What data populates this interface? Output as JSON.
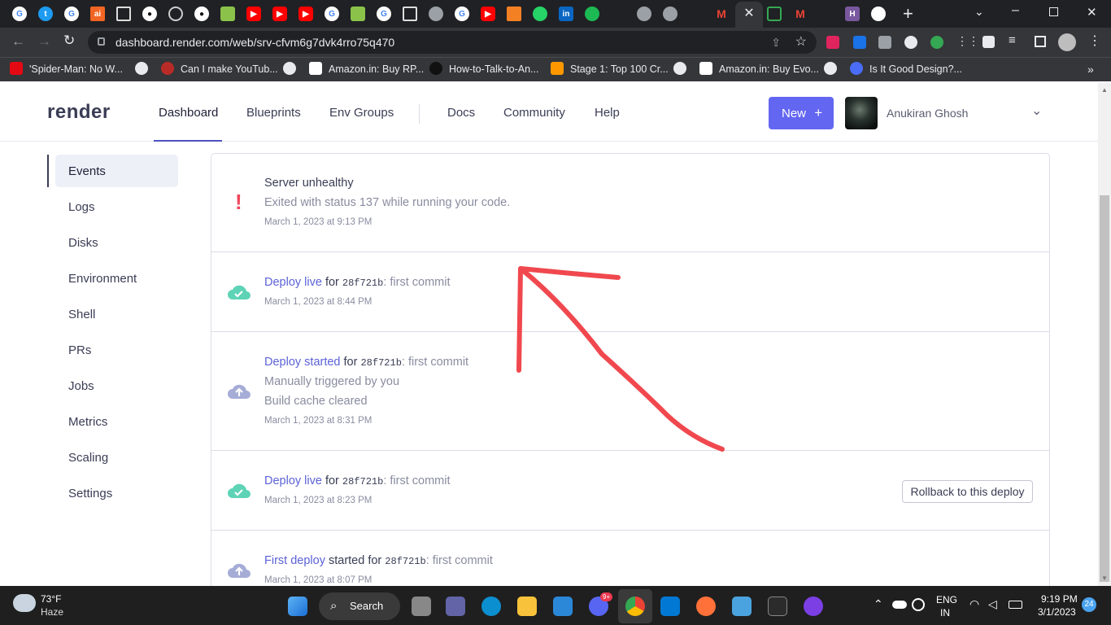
{
  "browser": {
    "url": "dashboard.render.com/web/srv-cfvm6g7dvk4rro75q470",
    "bookmarks": [
      "'Spider-Man: No W...",
      "Can I make YouTub...",
      "Amazon.in: Buy RP...",
      "How-to-Talk-to-An...",
      "Stage 1: Top 100 Cr...",
      "Amazon.in: Buy Evo...",
      "Is It Good Design?..."
    ],
    "close_tab_glyph": "✕",
    "new_tab_glyph": "+"
  },
  "app": {
    "logo": "render",
    "nav": [
      "Dashboard",
      "Blueprints",
      "Env Groups",
      "Docs",
      "Community",
      "Help"
    ],
    "active_nav": "Dashboard",
    "new_button": "New",
    "user_name": "Anukiran Ghosh",
    "accent": "#6366f1"
  },
  "sidebar": {
    "items": [
      "Events",
      "Logs",
      "Disks",
      "Environment",
      "Shell",
      "PRs",
      "Jobs",
      "Metrics",
      "Scaling",
      "Settings"
    ],
    "active": "Events"
  },
  "events": [
    {
      "icon": "exclamation-icon",
      "title": "Server unhealthy",
      "line2": "Exited with status 137 while running your code.",
      "date": "March 1, 2023 at 9:13 PM"
    },
    {
      "icon": "cloud-check-icon",
      "title_a": "Deploy live",
      "title_b": " for ",
      "commit": "28f721b",
      "title_c": ": first commit",
      "date": "March 1, 2023 at 8:44 PM"
    },
    {
      "icon": "cloud-upload-icon",
      "title_a": "Deploy started",
      "title_b": " for ",
      "commit": "28f721b",
      "title_c": ": first commit",
      "line2": "Manually triggered by you",
      "line3": "Build cache cleared",
      "date": "March 1, 2023 at 8:31 PM"
    },
    {
      "icon": "cloud-check-icon",
      "title_a": "Deploy live",
      "title_b": " for ",
      "commit": "28f721b",
      "title_c": ": first commit",
      "date": "March 1, 2023 at 8:23 PM",
      "action": "Rollback to this deploy"
    },
    {
      "icon": "cloud-upload-icon",
      "title_a": "First deploy",
      "title_b": " started for ",
      "commit": "28f721b",
      "title_c": ": first commit",
      "date": "March 1, 2023 at 8:07 PM"
    }
  ],
  "taskbar": {
    "weather_temp": "73°F",
    "weather_desc": "Haze",
    "search": "Search",
    "lang": "ENG",
    "region": "IN",
    "time": "9:19 PM",
    "date": "3/1/2023",
    "notif_count": "24",
    "discord_badge": "9+"
  }
}
